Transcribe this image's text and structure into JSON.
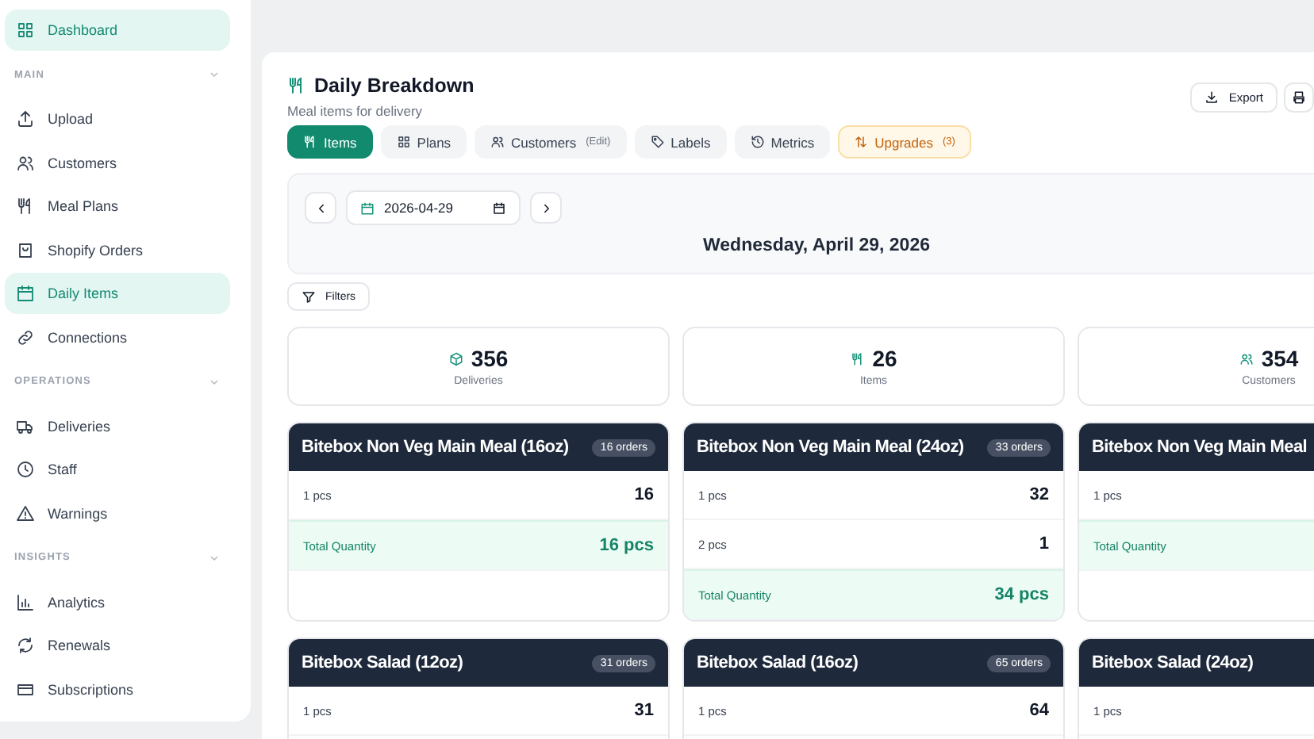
{
  "sidebar": {
    "top_item": {
      "label": "Dashboard",
      "selected": true
    },
    "sections": [
      {
        "label": "MAIN",
        "expanded": true,
        "items": [
          {
            "label": "Upload",
            "selected": false
          },
          {
            "label": "Customers",
            "selected": false
          },
          {
            "label": "Meal Plans",
            "selected": false
          },
          {
            "label": "Shopify Orders",
            "selected": false
          },
          {
            "label": "Daily Items",
            "selected": true
          },
          {
            "label": "Connections",
            "selected": false
          }
        ]
      },
      {
        "label": "OPERATIONS",
        "expanded": true,
        "items": [
          {
            "label": "Deliveries",
            "selected": false
          },
          {
            "label": "Staff",
            "selected": false
          },
          {
            "label": "Warnings",
            "selected": false
          }
        ]
      },
      {
        "label": "INSIGHTS",
        "expanded": true,
        "items": [
          {
            "label": "Analytics",
            "selected": false
          },
          {
            "label": "Renewals",
            "selected": false
          },
          {
            "label": "Subscriptions",
            "selected": false
          }
        ]
      }
    ]
  },
  "header": {
    "title": "Daily Breakdown",
    "subtitle": "Meal items for delivery",
    "export_button": "Export"
  },
  "tabs": [
    {
      "label": "Items",
      "kind": "normal",
      "selected": true
    },
    {
      "label": "Plans",
      "kind": "normal",
      "selected": false
    },
    {
      "label": "Customers",
      "note": "(Edit)",
      "kind": "normal",
      "selected": false
    },
    {
      "label": "Labels",
      "kind": "normal",
      "selected": false
    },
    {
      "label": "Metrics",
      "kind": "normal",
      "selected": false
    },
    {
      "label": "Upgrades",
      "note": "(3)",
      "kind": "warning",
      "selected": false
    }
  ],
  "date_bar": {
    "date": "2026-04-29",
    "heading": "Wednesday, April 29, 2026"
  },
  "filters_button": "Filters",
  "stats": [
    {
      "value": "356",
      "label": "Deliveries"
    },
    {
      "value": "26",
      "label": "Items"
    },
    {
      "value": "354",
      "label": "Customers"
    }
  ],
  "cards": [
    {
      "title": "Bitebox Non Veg Main Meal (16oz)",
      "badge": "16 orders",
      "rows": [
        {
          "label": "1 pcs",
          "value": "16"
        }
      ],
      "total": {
        "label": "Total Quantity",
        "value": "16 pcs"
      }
    },
    {
      "title": "Bitebox Non Veg Main Meal (24oz)",
      "badge": "33 orders",
      "rows": [
        {
          "label": "1 pcs",
          "value": "32"
        },
        {
          "label": "2 pcs",
          "value": "1"
        }
      ],
      "total": {
        "label": "Total Quantity",
        "value": "34 pcs"
      }
    },
    {
      "title": "Bitebox Non Veg Main Meal",
      "rows": [
        {
          "label": "1 pcs"
        }
      ],
      "total": {
        "label": "Total Quantity"
      }
    },
    {
      "title": "Bitebox Salad (12oz)",
      "badge": "31 orders",
      "rows": [
        {
          "label": "1 pcs",
          "value": "31"
        }
      ]
    },
    {
      "title": "Bitebox Salad (16oz)",
      "badge": "65 orders",
      "rows": [
        {
          "label": "1 pcs",
          "value": "64"
        }
      ]
    },
    {
      "title": "Bitebox Salad (24oz)",
      "rows": [
        {
          "label": "1 pcs"
        }
      ]
    }
  ]
}
